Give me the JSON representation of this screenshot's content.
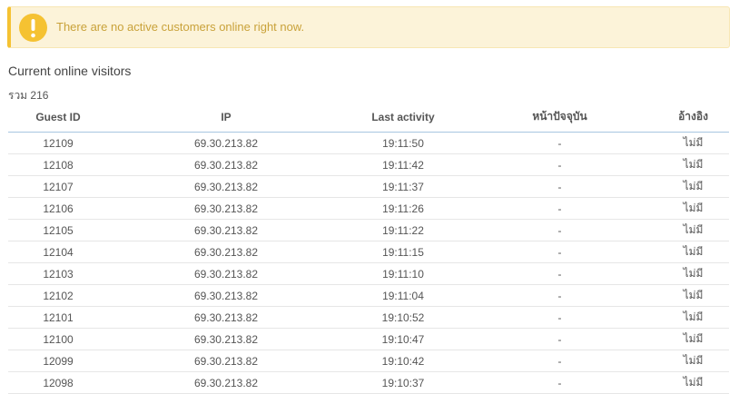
{
  "alert": {
    "message": "There are no active customers online right now.",
    "icon": "exclamation-circle-icon",
    "color": "#f5c232"
  },
  "visitors": {
    "title": "Current online visitors",
    "total_label": "รวม 216",
    "columns": [
      "Guest ID",
      "IP",
      "Last activity",
      "หน้าปัจจุบัน",
      "อ้างอิง"
    ],
    "rows": [
      [
        "12109",
        "69.30.213.82",
        "19:11:50",
        "-",
        "ไม่มี"
      ],
      [
        "12108",
        "69.30.213.82",
        "19:11:42",
        "-",
        "ไม่มี"
      ],
      [
        "12107",
        "69.30.213.82",
        "19:11:37",
        "-",
        "ไม่มี"
      ],
      [
        "12106",
        "69.30.213.82",
        "19:11:26",
        "-",
        "ไม่มี"
      ],
      [
        "12105",
        "69.30.213.82",
        "19:11:22",
        "-",
        "ไม่มี"
      ],
      [
        "12104",
        "69.30.213.82",
        "19:11:15",
        "-",
        "ไม่มี"
      ],
      [
        "12103",
        "69.30.213.82",
        "19:11:10",
        "-",
        "ไม่มี"
      ],
      [
        "12102",
        "69.30.213.82",
        "19:11:04",
        "-",
        "ไม่มี"
      ],
      [
        "12101",
        "69.30.213.82",
        "19:10:52",
        "-",
        "ไม่มี"
      ],
      [
        "12100",
        "69.30.213.82",
        "19:10:47",
        "-",
        "ไม่มี"
      ],
      [
        "12099",
        "69.30.213.82",
        "19:10:42",
        "-",
        "ไม่มี"
      ],
      [
        "12098",
        "69.30.213.82",
        "19:10:37",
        "-",
        "ไม่มี"
      ]
    ]
  }
}
